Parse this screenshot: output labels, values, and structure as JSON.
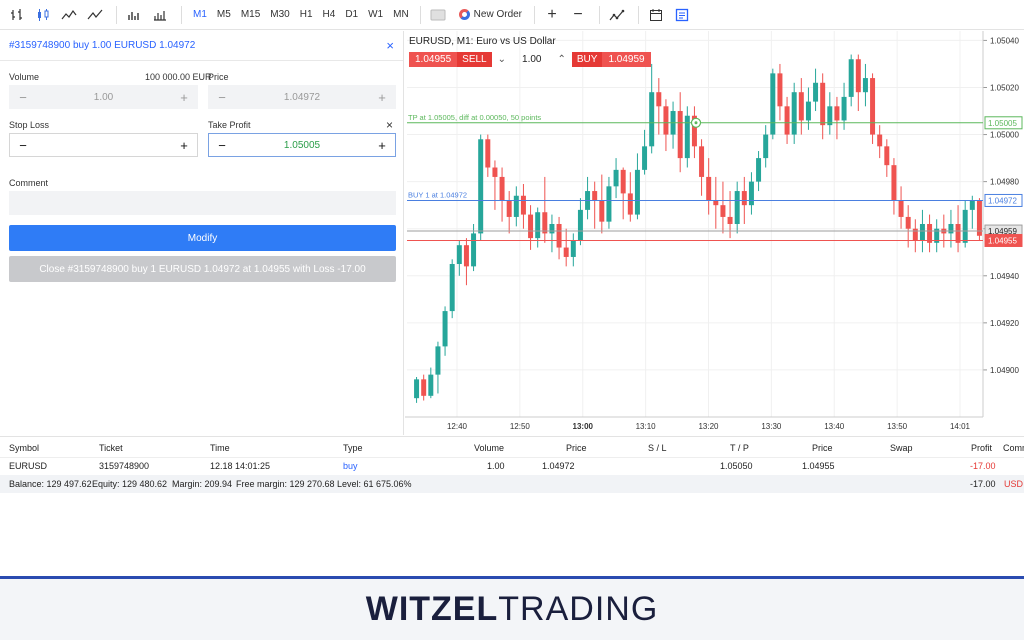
{
  "toolbar": {
    "timeframes": [
      "M1",
      "M5",
      "M15",
      "M30",
      "H1",
      "H4",
      "D1",
      "W1",
      "MN"
    ],
    "active_timeframe": "M1",
    "new_order_label": "New Order",
    "plus": "+",
    "minus": "−"
  },
  "order_panel": {
    "title": "#3159748900 buy 1.00 EURUSD 1.04972",
    "close_icon": "×",
    "volume_label": "Volume",
    "volume_amount": "100 000.00 EUR",
    "volume_value": "1.00",
    "price_label": "Price",
    "price_value": "1.04972",
    "stop_loss_label": "Stop Loss",
    "take_profit_label": "Take Profit",
    "take_profit_clear": "×",
    "stop_loss_value": "",
    "take_profit_value": "1.05005",
    "comment_label": "Comment",
    "comment_value": "",
    "modify_label": "Modify",
    "close_label": "Close #3159748900 buy 1 EURUSD 1.04972 at 1.04955 with Loss -17.00"
  },
  "chart": {
    "title": "EURUSD, M1: Euro vs US Dollar",
    "sell_price": "1.04955",
    "sell_label": "SELL",
    "lot": "1.00",
    "buy_label": "BUY",
    "buy_price": "1.04959",
    "tp_line_label": "TP at 1.05005, diff at 0.00050, 50 points",
    "buy_line_label": "BUY 1 at 1.04972"
  },
  "chart_data": {
    "type": "candlestick",
    "title": "EURUSD, M1: Euro vs US Dollar",
    "x_ticks": [
      "12:40",
      "12:50",
      "13:00",
      "13:10",
      "13:20",
      "13:30",
      "13:40",
      "13:50",
      "14:01"
    ],
    "y_ticks": [
      "1.05040",
      "1.05020",
      "1.05000",
      "1.04980",
      "1.04960",
      "1.04940",
      "1.04920",
      "1.04900"
    ],
    "ylim": [
      1.0488,
      1.05044
    ],
    "lines": [
      {
        "name": "TP",
        "value": 1.05005,
        "color": "#5cb85c",
        "tag": "1.05005"
      },
      {
        "name": "BUY",
        "value": 1.04972,
        "color": "#4a7fe0",
        "tag": "1.04972"
      },
      {
        "name": "ask",
        "value": 1.04959,
        "color": "#9e9e9e",
        "tag": "1.04959"
      },
      {
        "name": "bid",
        "value": 1.04955,
        "color": "#ef5350",
        "tag": "1.04955"
      }
    ],
    "candles": [
      [
        1.04888,
        1.04896,
        1.04886,
        1.04897
      ],
      [
        1.04896,
        1.04889,
        1.04887,
        1.04898
      ],
      [
        1.04889,
        1.04898,
        1.04888,
        1.04901
      ],
      [
        1.04898,
        1.0491,
        1.0489,
        1.04912
      ],
      [
        1.0491,
        1.04925,
        1.04906,
        1.04927
      ],
      [
        1.04925,
        1.04945,
        1.04922,
        1.04947
      ],
      [
        1.04945,
        1.04953,
        1.0494,
        1.04955
      ],
      [
        1.04953,
        1.04944,
        1.04936,
        1.04956
      ],
      [
        1.04944,
        1.04958,
        1.04942,
        1.04962
      ],
      [
        1.04958,
        1.04998,
        1.04955,
        1.05
      ],
      [
        1.04998,
        1.04986,
        1.04982,
        1.05
      ],
      [
        1.04986,
        1.04982,
        1.04968,
        1.04989
      ],
      [
        1.04982,
        1.04972,
        1.04963,
        1.04986
      ],
      [
        1.04972,
        1.04965,
        1.04958,
        1.04976
      ],
      [
        1.04965,
        1.04974,
        1.04961,
        1.04978
      ],
      [
        1.04974,
        1.04966,
        1.0496,
        1.04979
      ],
      [
        1.04966,
        1.04956,
        1.04951,
        1.0497
      ],
      [
        1.04956,
        1.04967,
        1.04952,
        1.04969
      ],
      [
        1.04967,
        1.04958,
        1.04954,
        1.04982
      ],
      [
        1.04958,
        1.04962,
        1.0495,
        1.04966
      ],
      [
        1.04962,
        1.04952,
        1.04947,
        1.04965
      ],
      [
        1.04952,
        1.04948,
        1.04944,
        1.0496
      ],
      [
        1.04948,
        1.04955,
        1.04944,
        1.04958
      ],
      [
        1.04955,
        1.04968,
        1.04953,
        1.04973
      ],
      [
        1.04968,
        1.04976,
        1.04964,
        1.04982
      ],
      [
        1.04976,
        1.04972,
        1.0496,
        1.0498
      ],
      [
        1.04972,
        1.04963,
        1.04958,
        1.04983
      ],
      [
        1.04963,
        1.04978,
        1.0496,
        1.04982
      ],
      [
        1.04978,
        1.04985,
        1.04973,
        1.0499
      ],
      [
        1.04985,
        1.04975,
        1.04964,
        1.04986
      ],
      [
        1.04975,
        1.04966,
        1.04963,
        1.04984
      ],
      [
        1.04966,
        1.04985,
        1.04964,
        1.04992
      ],
      [
        1.04985,
        1.04995,
        1.04983,
        1.05002
      ],
      [
        1.04995,
        1.05018,
        1.04992,
        1.0503
      ],
      [
        1.05018,
        1.05012,
        1.05,
        1.05024
      ],
      [
        1.05012,
        1.05,
        1.04993,
        1.05015
      ],
      [
        1.05,
        1.0501,
        1.04994,
        1.05014
      ],
      [
        1.0501,
        1.0499,
        1.04984,
        1.05018
      ],
      [
        1.0499,
        1.05008,
        1.04986,
        1.05012
      ],
      [
        1.05008,
        1.04995,
        1.0499,
        1.05012
      ],
      [
        1.04995,
        1.04982,
        1.04974,
        1.04998
      ],
      [
        1.04982,
        1.04972,
        1.04966,
        1.0499
      ],
      [
        1.04972,
        1.0497,
        1.0496,
        1.04982
      ],
      [
        1.0497,
        1.04965,
        1.04958,
        1.0498
      ],
      [
        1.04965,
        1.04962,
        1.04956,
        1.04976
      ],
      [
        1.04962,
        1.04976,
        1.04958,
        1.0498
      ],
      [
        1.04976,
        1.0497,
        1.04962,
        1.04982
      ],
      [
        1.0497,
        1.0498,
        1.04966,
        1.04984
      ],
      [
        1.0498,
        1.0499,
        1.04976,
        1.04993
      ],
      [
        1.0499,
        1.05,
        1.04986,
        1.05004
      ],
      [
        1.05,
        1.05026,
        1.04998,
        1.05028
      ],
      [
        1.05026,
        1.05012,
        1.05006,
        1.0503
      ],
      [
        1.05012,
        1.05,
        1.04996,
        1.05016
      ],
      [
        1.05,
        1.05018,
        1.04996,
        1.05022
      ],
      [
        1.05018,
        1.05006,
        1.05,
        1.05024
      ],
      [
        1.05006,
        1.05014,
        1.05002,
        1.0502
      ],
      [
        1.05014,
        1.05022,
        1.0501,
        1.05028
      ],
      [
        1.05022,
        1.05004,
        1.04998,
        1.05026
      ],
      [
        1.05004,
        1.05012,
        1.05,
        1.05018
      ],
      [
        1.05012,
        1.05006,
        1.04998,
        1.05016
      ],
      [
        1.05006,
        1.05016,
        1.05002,
        1.05022
      ],
      [
        1.05016,
        1.05032,
        1.05012,
        1.05034
      ],
      [
        1.05032,
        1.05018,
        1.0501,
        1.05034
      ],
      [
        1.05018,
        1.05024,
        1.05012,
        1.0503
      ],
      [
        1.05024,
        1.05,
        1.04996,
        1.05026
      ],
      [
        1.05,
        1.04995,
        1.0499,
        1.05004
      ],
      [
        1.04995,
        1.04987,
        1.04982,
        1.04998
      ],
      [
        1.04987,
        1.04972,
        1.04966,
        1.0499
      ],
      [
        1.04972,
        1.04965,
        1.0496,
        1.04978
      ],
      [
        1.04965,
        1.0496,
        1.04952,
        1.0497
      ],
      [
        1.0496,
        1.04955,
        1.0495,
        1.04964
      ],
      [
        1.04955,
        1.04962,
        1.0495,
        1.04968
      ],
      [
        1.04962,
        1.04954,
        1.0495,
        1.04966
      ],
      [
        1.04954,
        1.0496,
        1.0495,
        1.04964
      ],
      [
        1.0496,
        1.04958,
        1.04952,
        1.04966
      ],
      [
        1.04958,
        1.04962,
        1.04952,
        1.04968
      ],
      [
        1.04962,
        1.04954,
        1.0495,
        1.0497
      ],
      [
        1.04954,
        1.04968,
        1.04952,
        1.04972
      ],
      [
        1.04968,
        1.04972,
        1.0496,
        1.04974
      ],
      [
        1.04972,
        1.04957,
        1.04955,
        1.04973
      ]
    ]
  },
  "positions": {
    "headers": [
      "Symbol",
      "Ticket",
      "Time",
      "Type",
      "Volume",
      "Price",
      "S / L",
      "T / P",
      "Price",
      "Swap",
      "Profit",
      "Comm"
    ],
    "rows": [
      [
        "EURUSD",
        "3159748900",
        "12.18 14:01:25",
        "buy",
        "1.00",
        "1.04972",
        "",
        "1.05050",
        "1.04955",
        "",
        "-17.00",
        ""
      ]
    ],
    "summary": {
      "balance": "Balance: 129 497.62",
      "equity": "Equity: 129 480.62",
      "margin": "Margin: 209.94",
      "free_margin": "Free margin: 129 270.68",
      "level": "Level: 61 675.06%",
      "total_profit": "-17.00",
      "currency": "USD"
    }
  },
  "footer": {
    "logo_bold": "WITZEL",
    "logo_thin": "TRADING"
  },
  "colors": {
    "accent": "#2962ff",
    "bull": "#26a69a",
    "bear": "#ef5350",
    "footer_rule": "#2a4bb0"
  }
}
